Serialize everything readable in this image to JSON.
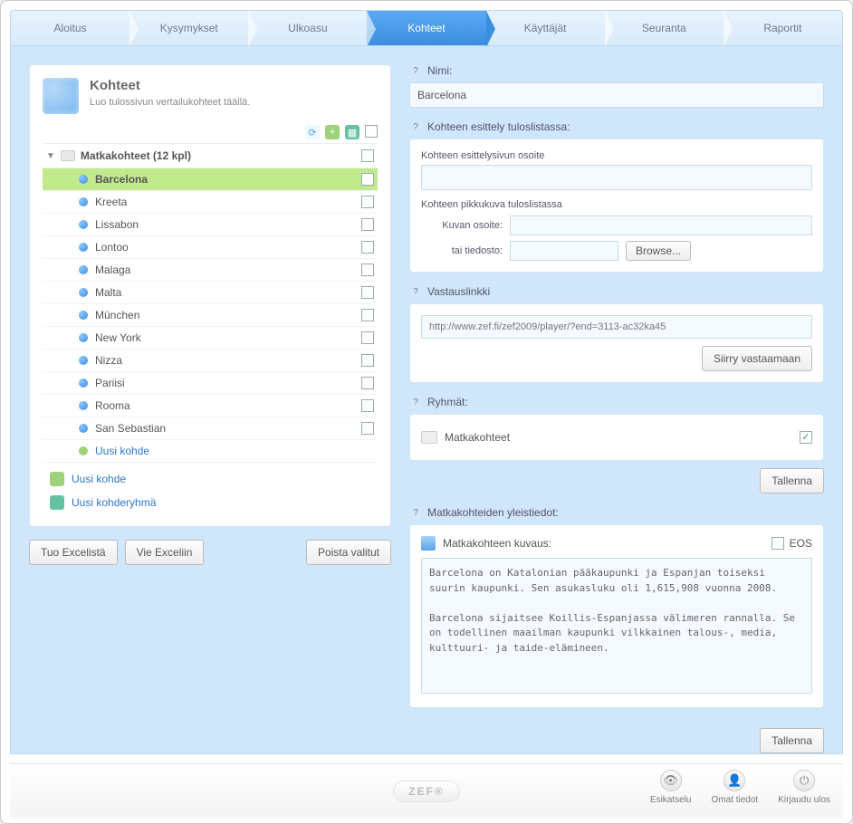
{
  "tabs": [
    "Aloitus",
    "Kysymykset",
    "Ulkoasu",
    "Kohteet",
    "Käyttäjät",
    "Seuranta",
    "Raportit"
  ],
  "active_tab_index": 3,
  "panel": {
    "title": "Kohteet",
    "subtitle": "Luo tulossivun vertailukohteet täällä."
  },
  "tree_header": "Matkakohteet (12 kpl)",
  "items": [
    {
      "label": "Barcelona",
      "selected": true
    },
    {
      "label": "Kreeta"
    },
    {
      "label": "Lissabon"
    },
    {
      "label": "Lontoo"
    },
    {
      "label": "Malaga"
    },
    {
      "label": "Malta"
    },
    {
      "label": "München"
    },
    {
      "label": "New York"
    },
    {
      "label": "Nizza"
    },
    {
      "label": "Pariisi"
    },
    {
      "label": "Rooma"
    },
    {
      "label": "San Sebastian"
    }
  ],
  "add_item_label": "Uusi kohde",
  "links": {
    "new_item": "Uusi kohde",
    "new_group": "Uusi kohderyhmä"
  },
  "buttons": {
    "import_excel": "Tuo Excelistä",
    "export_excel": "Vie Exceliin",
    "delete_selected": "Poista valitut",
    "browse": "Browse...",
    "go_answer": "Siirry vastaamaan",
    "save": "Tallenna"
  },
  "labels": {
    "name": "Nimi:",
    "presentation": "Kohteen esittely tuloslistassa:",
    "page_address": "Kohteen esittelysivun osoite",
    "thumb": "Kohteen pikkukuva tuloslistassa",
    "img_url": "Kuvan osoite:",
    "or_file": "tai tiedosto:",
    "answer_link": "Vastauslinkki",
    "groups": "Ryhmät:",
    "overview": "Matkakohteiden yleistiedot:",
    "desc": "Matkakohteen kuvaus:",
    "eos": "EOS"
  },
  "values": {
    "name": "Barcelona",
    "answer_url": "http://www.zef.fi/zef2009/player/?end=3113-ac32ka45",
    "group_name": "Matkakohteet",
    "group_checked": true,
    "description": "Barcelona on Katalonian pääkaupunki ja Espanjan toiseksi suurin kaupunki. Sen asukasluku oli 1,615,908 vuonna 2008.\n\nBarcelona sijaitsee Koillis-Espanjassa välimeren rannalla. Se on todellinen maailman kaupunki vilkkainen talous-, media, kulttuuri- ja taide-elämineen."
  },
  "brand": "ZEF®",
  "footer": {
    "preview": "Esikatselu",
    "profile": "Omat tiedot",
    "logout": "Kirjaudu ulos"
  }
}
